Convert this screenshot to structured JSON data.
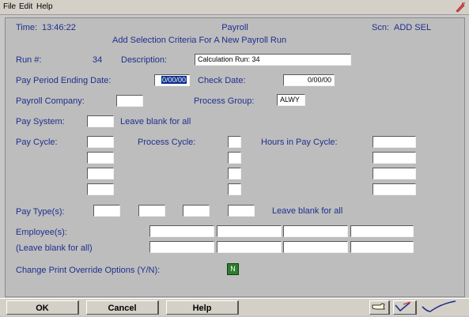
{
  "menu": {
    "file": "File",
    "edit": "Edit",
    "help": "Help"
  },
  "header": {
    "time_label": "Time:",
    "time_value": "13:46:22",
    "app_title": "Payroll",
    "subtitle": "Add Selection Criteria For A New Payroll Run",
    "scn_label": "Scn:",
    "scn_value": "ADD SEL"
  },
  "form": {
    "run_label": "Run #:",
    "run_value": "34",
    "description_label": "Description:",
    "description_value": "Calculation Run: 34",
    "pay_period_label": "Pay Period Ending Date:",
    "pay_period_value": "0/00/00",
    "check_date_label": "Check Date:",
    "check_date_value": "0/00/00",
    "payroll_company_label": "Payroll Company:",
    "payroll_company_value": "",
    "process_group_label": "Process Group:",
    "process_group_value": "ALWY",
    "pay_system_label": "Pay System:",
    "pay_system_value": "",
    "pay_system_hint": "Leave blank for all",
    "pay_cycle_label": "Pay Cycle:",
    "process_cycle_label": "Process Cycle:",
    "hours_label": "Hours in Pay Cycle:",
    "pay_types_label": "Pay Type(s):",
    "pay_types_hint": "Leave blank for all",
    "employees_label": "Employee(s):",
    "employees_hint": "(Leave blank for all)",
    "print_override_label": "Change Print Override Options (Y/N):",
    "print_override_value": "N"
  },
  "buttons": {
    "ok": "OK",
    "cancel": "Cancel",
    "help": "Help"
  },
  "icons": {
    "corner": "pen-icon",
    "nav_back": "hand-point-icon",
    "nav_mid": "pen-check-icon",
    "nav_ok": "checkmark-icon"
  }
}
